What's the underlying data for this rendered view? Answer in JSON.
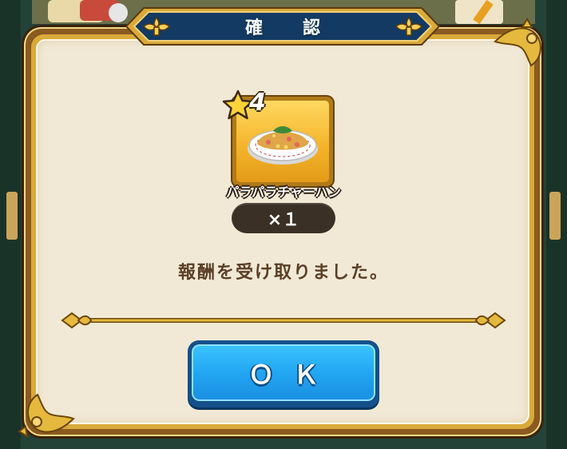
{
  "dialog": {
    "title": "確　認",
    "message": "報酬を受け取りました。",
    "ok_label": "ＯＫ"
  },
  "reward": {
    "rarity": "4",
    "name": "パラパラチャーハン",
    "quantity": "×１"
  },
  "colors": {
    "frame_gold": "#d9a93a",
    "panel_cream": "#f1e9d6",
    "banner_navy": "#123a63",
    "button_blue": "#22a6f2",
    "text_brown": "#5a3f26"
  },
  "icons": [
    "fleur-de-lis-icon",
    "star-icon",
    "fried-rice-icon",
    "corner-ornament-icon"
  ]
}
